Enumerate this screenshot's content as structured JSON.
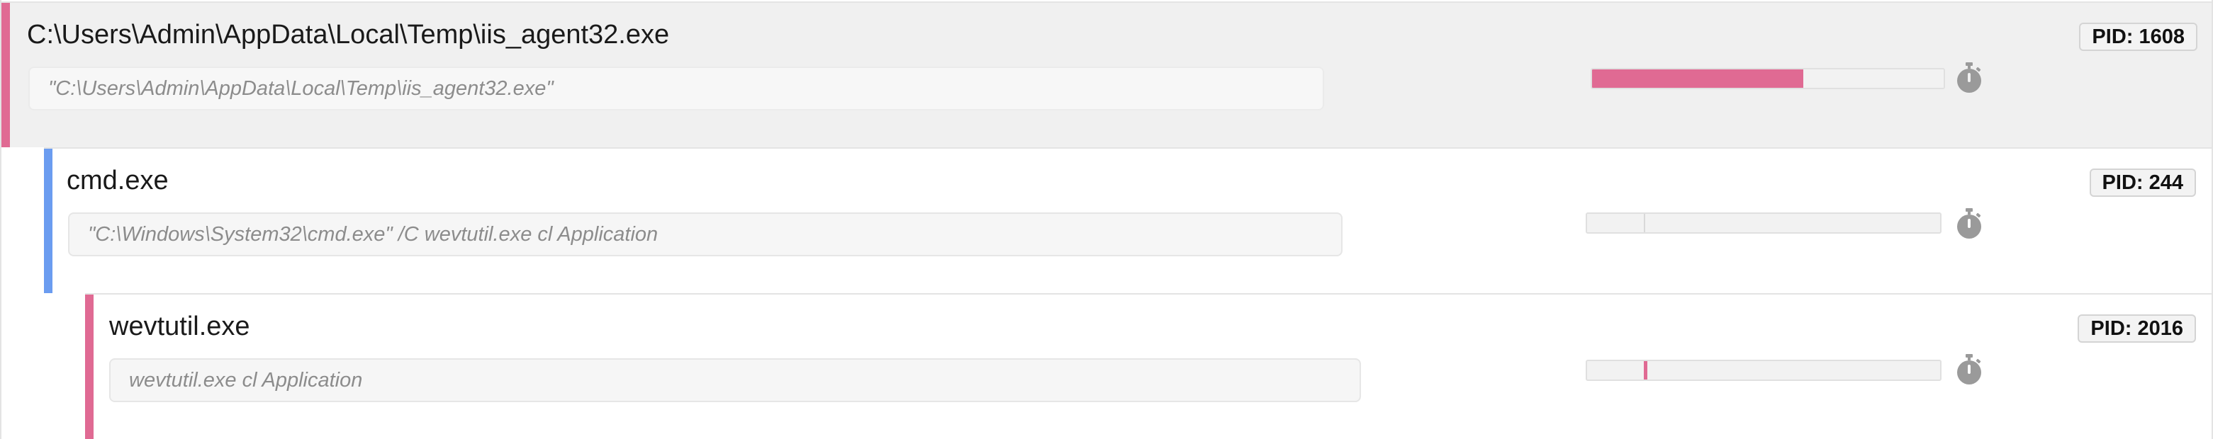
{
  "colors": {
    "pink_accent": "#e06a93",
    "blue_accent": "#6b9cf0",
    "bar_fill": "#e06a93",
    "timer_icon": "#9a9a9a"
  },
  "processes": [
    {
      "name": "C:\\Users\\Admin\\AppData\\Local\\Temp\\iis_agent32.exe",
      "command_line": "\"C:\\Users\\Admin\\AppData\\Local\\Temp\\iis_agent32.exe\"",
      "pid_label": "PID: 1608",
      "accent": "pink",
      "runtime": {
        "start_fraction": 0.0,
        "end_fraction": 0.6
      },
      "timer_icon": "stopwatch-icon"
    },
    {
      "name": "cmd.exe",
      "command_line": "\"C:\\Windows\\System32\\cmd.exe\" /C wevtutil.exe cl Application",
      "pid_label": "PID: 244",
      "accent": "blue",
      "runtime": {
        "start_fraction": 0.16,
        "end_fraction": 0.165
      },
      "timer_icon": "stopwatch-icon"
    },
    {
      "name": "wevtutil.exe",
      "command_line": "wevtutil.exe cl Application",
      "pid_label": "PID: 2016",
      "accent": "pink",
      "runtime": {
        "start_fraction": 0.16,
        "end_fraction": 0.17
      },
      "timer_icon": "stopwatch-icon"
    }
  ]
}
